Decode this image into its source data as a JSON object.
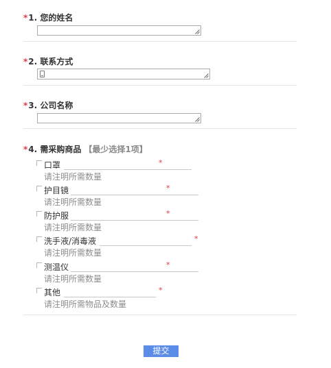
{
  "required_mark": "*",
  "colors": {
    "required": "#e4393c",
    "submit_bg": "#5b8de8"
  },
  "questions": [
    {
      "number": "1.",
      "title": "您的姓名"
    },
    {
      "number": "2.",
      "title": "联系方式",
      "icon": "phone-icon"
    },
    {
      "number": "3.",
      "title": "公司名称"
    },
    {
      "number": "4.",
      "title": "需采购商品",
      "hint": "【最少选择1项】"
    }
  ],
  "items": [
    {
      "label": "口罩",
      "note": "请注明所需数量"
    },
    {
      "label": "护目镜",
      "note": "请注明所需数量"
    },
    {
      "label": "防护服",
      "note": "请注明所需数量"
    },
    {
      "label": "洗手液/消毒液",
      "note": "请注明所需数量"
    },
    {
      "label": "测温仪",
      "note": "请注明所需数量"
    },
    {
      "label": "其他",
      "note": "请注明所需物品及数量"
    }
  ],
  "submit_label": "提交"
}
